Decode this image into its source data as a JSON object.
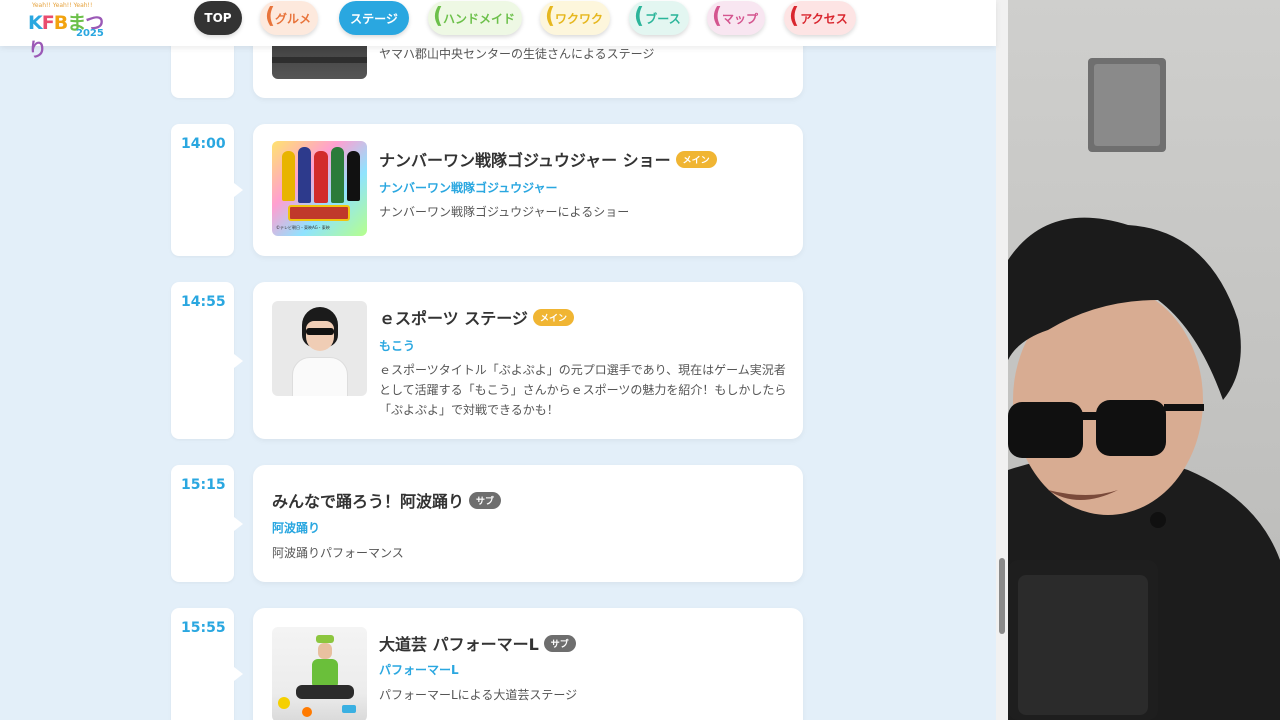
{
  "logo": {
    "tiny": "Yeah!! Yeah!! Yeah!!",
    "letters": [
      "K",
      "F",
      "B",
      "ま",
      "つり"
    ],
    "year": "2025"
  },
  "nav": [
    {
      "label": "TOP",
      "color": "#333333",
      "text_color": "#ffffff",
      "active": true
    },
    {
      "label": "グルメ",
      "color": "#fde9dd",
      "text_color": "#e8743b"
    },
    {
      "label": "ステージ",
      "color": "#2aa7e0",
      "text_color": "#ffffff",
      "active": true
    },
    {
      "label": "ハンドメイド",
      "color": "#eef8e4",
      "text_color": "#6cc04a"
    },
    {
      "label": "ワクワク",
      "color": "#fdf6dc",
      "text_color": "#e6b71e"
    },
    {
      "label": "ブース",
      "color": "#e3f6f1",
      "text_color": "#2bb59a"
    },
    {
      "label": "マップ",
      "color": "#f8e6f1",
      "text_color": "#d4558f"
    },
    {
      "label": "アクセス",
      "color": "#fde4e4",
      "text_color": "#d9262e"
    }
  ],
  "events": [
    {
      "time": "",
      "title": "",
      "badge": "",
      "performer": "",
      "desc": "ヤマハ郡山中央センターの生徒さんによるステージ"
    },
    {
      "time": "14:00",
      "title": "ナンバーワン戦隊ゴジュウジャー ショー",
      "badge": "メイン",
      "badge_type": "main",
      "performer": "ナンバーワン戦隊ゴジュウジャー",
      "desc": "ナンバーワン戦隊ゴジュウジャーによるショー",
      "thumb_caption": "©テレビ朝日・東映AG・東映"
    },
    {
      "time": "14:55",
      "title": "ｅスポーツ ステージ",
      "badge": "メイン",
      "badge_type": "main",
      "performer": "もこう",
      "desc": "ｅスポーツタイトル「ぷよぷよ」の元プロ選手であり、現在はゲーム実況者として活躍する「もこう」さんからｅスポーツの魅力を紹介！もしかしたら「ぷよぷよ」で対戦できるかも！"
    },
    {
      "time": "15:15",
      "title": "みんなで踊ろう！阿波踊り",
      "badge": "サブ",
      "badge_type": "sub",
      "performer": "阿波踊り",
      "desc": "阿波踊りパフォーマンス"
    },
    {
      "time": "15:55",
      "title": "大道芸 パフォーマーL",
      "badge": "サブ",
      "badge_type": "sub",
      "performer": "パフォーマーL",
      "desc": "パフォーマーLによる大道芸ステージ"
    }
  ]
}
